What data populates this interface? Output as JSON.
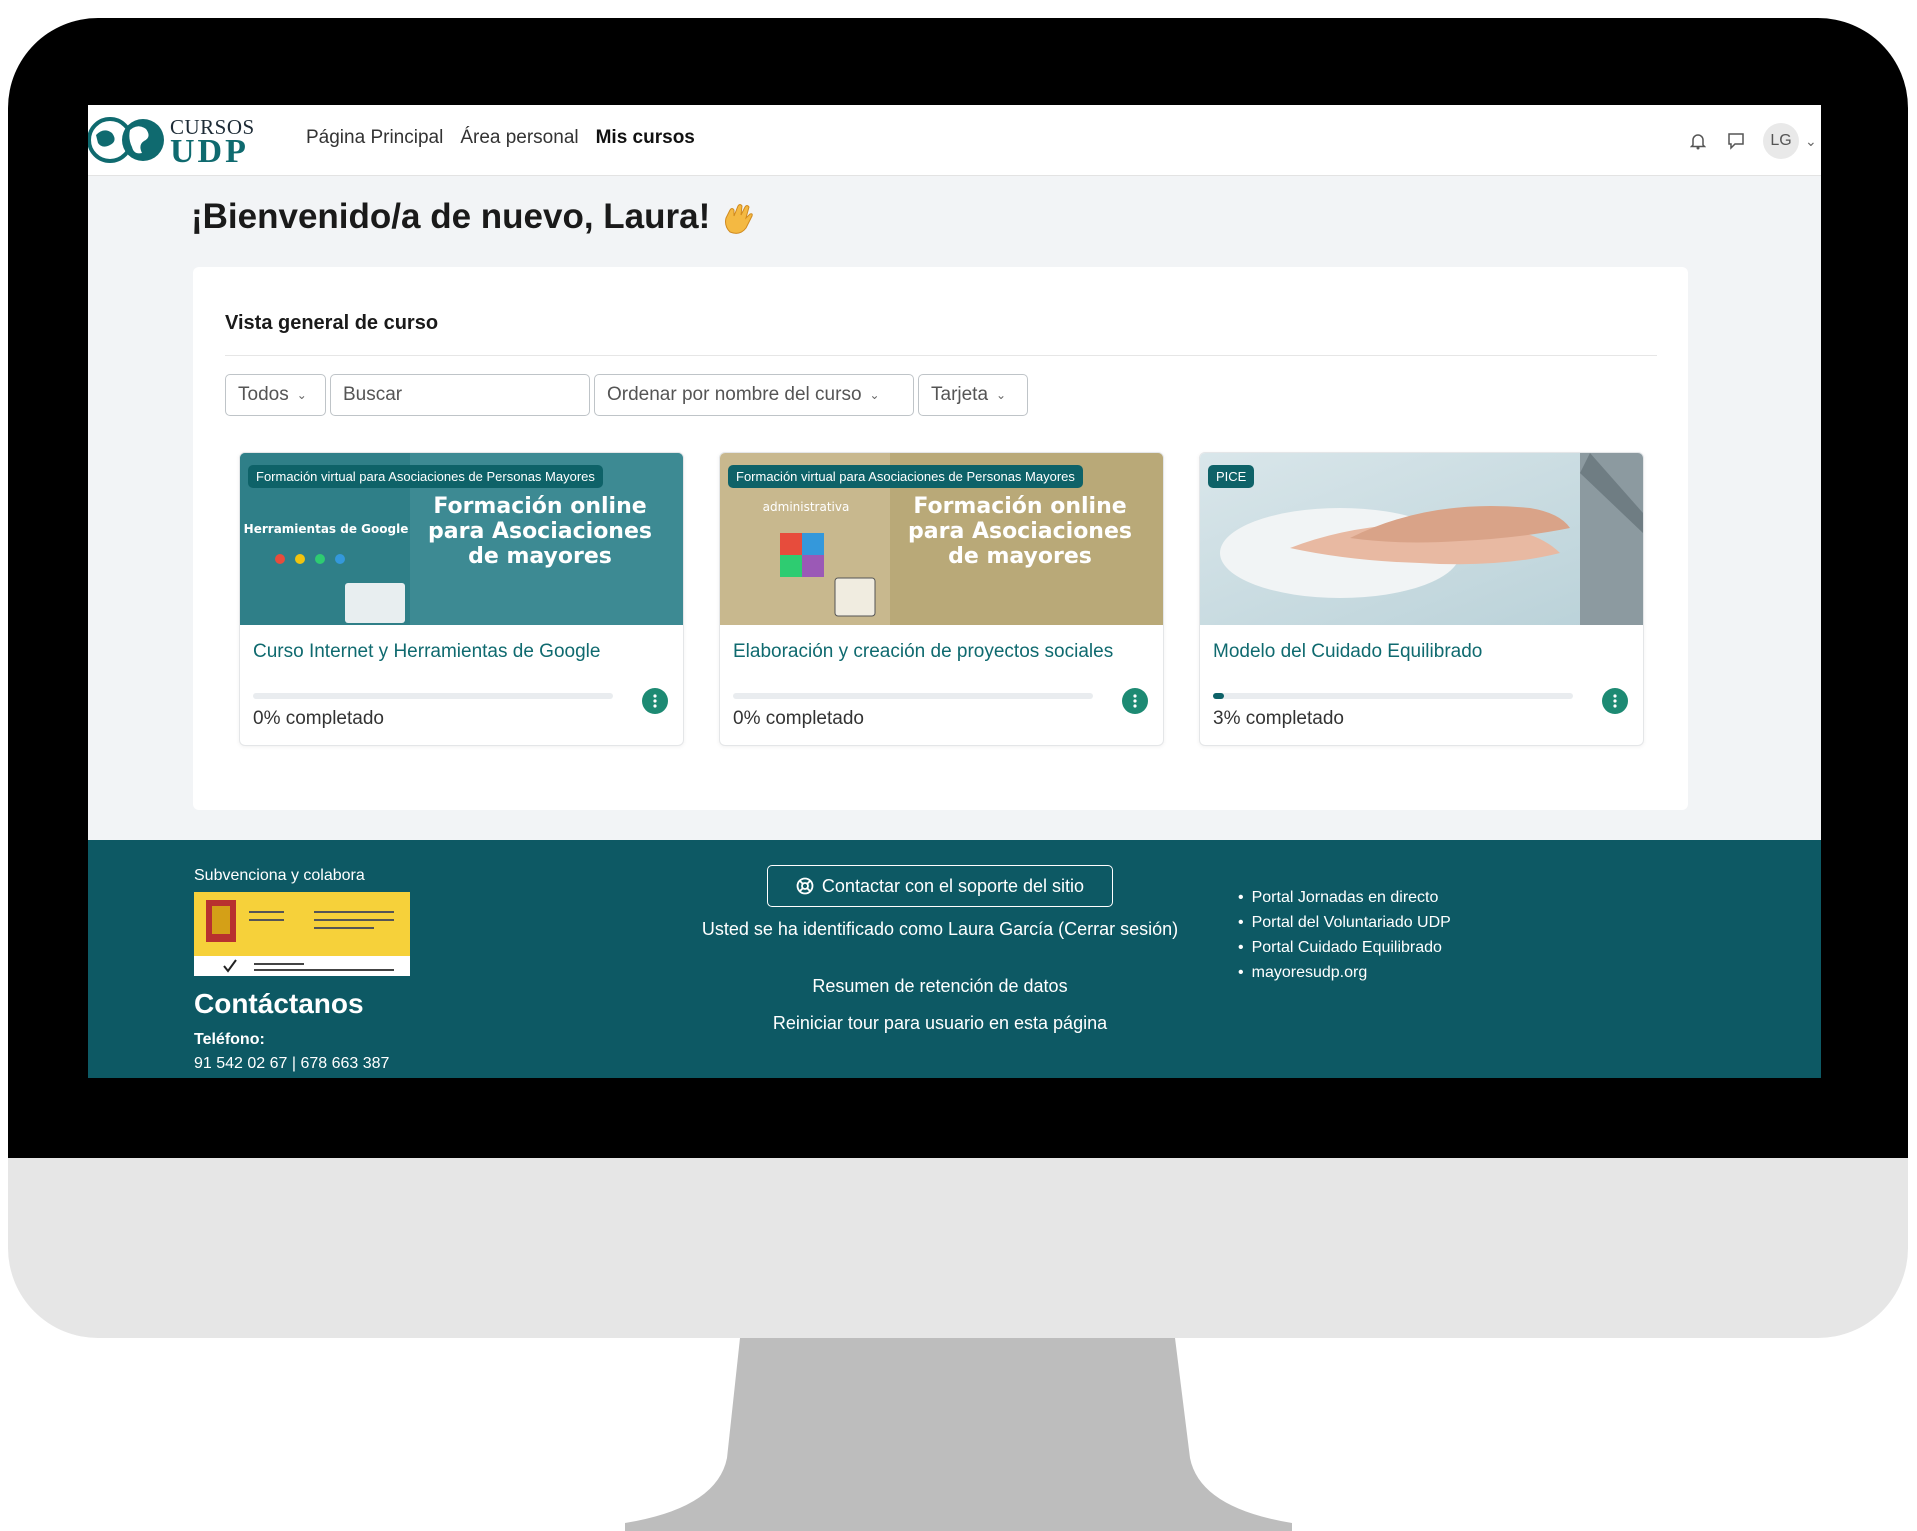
{
  "logo": {
    "top": "CURSOS",
    "bottom": "UDP"
  },
  "nav": {
    "links": [
      "Página Principal",
      "Área personal",
      "Mis cursos"
    ],
    "avatar_initials": "LG"
  },
  "welcome": "¡Bienvenido/a de nuevo, Laura!",
  "overview": {
    "title": "Vista general de curso",
    "filter": "Todos",
    "search_placeholder": "Buscar",
    "sort": "Ordenar por nombre del curso",
    "view": "Tarjeta"
  },
  "courses": [
    {
      "badge": "Formación virtual para Asociaciones de Personas Mayores",
      "title": "Curso Internet y Herramientas de Google",
      "progress": 0,
      "progress_label": "0% completado",
      "image_text": {
        "headline": "Formación online para Asociaciones de mayores",
        "side": "Herramientas de Google"
      }
    },
    {
      "badge": "Formación virtual para Asociaciones de Personas Mayores",
      "title": "Elaboración y creación de proyectos sociales",
      "progress": 0,
      "progress_label": "0% completado",
      "image_text": {
        "headline": "Formación online para Asociaciones de mayores",
        "side": "administrativa"
      }
    },
    {
      "badge": "PICE",
      "title": "Modelo del Cuidado Equilibrado",
      "progress": 3,
      "progress_label": "3% completado"
    }
  ],
  "footer": {
    "sponsor_label": "Subvenciona y colabora",
    "contact_title": "Contáctanos",
    "phone_label": "Teléfono:",
    "phone": "91 542 02 67 | 678 663 387",
    "support_button": "Contactar con el soporte del sitio",
    "logged_in": "Usted se ha identificado como Laura García (Cerrar sesión)",
    "data_retention": "Resumen de retención de datos",
    "reset_tour": "Reiniciar tour para usuario en esta página",
    "links": [
      "Portal Jornadas en directo",
      "Portal del Voluntariado UDP",
      "Portal Cuidado Equilibrado",
      "mayoresudp.org"
    ]
  },
  "colors": {
    "brand": "#0d5964",
    "accent": "#0f6a6f",
    "progress": "#0e6268",
    "menu_button": "#1d8a73"
  }
}
